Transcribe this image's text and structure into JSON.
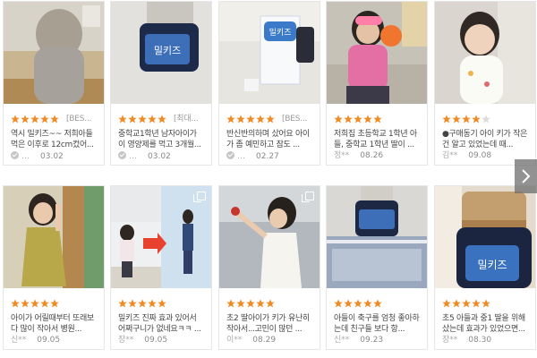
{
  "colors": {
    "star_filled": "#f08a24",
    "star_empty": "#dcdcdc",
    "next_arrow_bg": "#6e6e6e"
  },
  "next_button_icon": "chevron-right-icon",
  "reviews": [
    {
      "image": "child-back-view",
      "rating": 5,
      "badge": "[BES...",
      "text": "역시 밀키즈~~ 저희아들 먹은 이후로 12cm컸어...",
      "author": "…",
      "verified": true,
      "date": "03.02"
    },
    {
      "image": "supplement-bottle",
      "rating": 5,
      "badge": "[최대...",
      "text": "중학교1학년 남자아이가 이 영양제를 먹고 3개월...",
      "author": "…",
      "verified": true,
      "date": "03.02"
    },
    {
      "image": "product-box-and-bottle",
      "rating": 5,
      "badge": "[BES...",
      "text": "반신반의하며 샀어요 아이가 좀 예민하고 잠도 ...",
      "author": "…",
      "verified": true,
      "date": "02.27"
    },
    {
      "image": "girl-with-toy",
      "rating": 5,
      "badge": "",
      "text": "저희집 초등학교 1학년 아들, 중학교 1학년 딸이 ...",
      "author": "정**",
      "verified": false,
      "date": "08.26"
    },
    {
      "image": "toddler-girl",
      "rating": 4,
      "badge": "",
      "text": "●구매동기 아이 키가 작은건 알고 있었는데 때...",
      "author": "김**",
      "verified": false,
      "date": "09.08"
    },
    {
      "image": "girl-yellow-dress",
      "rating": 5,
      "badge": "",
      "text": "아이가 어릴때부터 또래보다 많이 작아서 병원...",
      "author": "신**",
      "verified": false,
      "date": "09.05"
    },
    {
      "image": "before-after-height",
      "rating": 5,
      "badge": "",
      "text": "밀키즈 진짜 효과 있어서 어쩌구니가 없네요ㅋㅋ ...",
      "author": "장**",
      "verified": false,
      "date": "09.05"
    },
    {
      "image": "girl-reaching",
      "rating": 5,
      "badge": "",
      "text": "초2 딸아이가 키가 유난히 작아서...고민이 많던 ...",
      "author": "이**",
      "verified": false,
      "date": "08.29"
    },
    {
      "image": "bottle-on-box",
      "rating": 5,
      "badge": "",
      "text": "아들이 축구를 엄청 좋아하는데 친구들 보다 항...",
      "author": "신**",
      "verified": false,
      "date": "09.23"
    },
    {
      "image": "bottle-closeup",
      "rating": 5,
      "badge": "",
      "text": "초5 아들과 중1 딸을 위해 샀는데 효과가 있었으면...",
      "author": "장**",
      "verified": false,
      "date": "08.30"
    }
  ]
}
